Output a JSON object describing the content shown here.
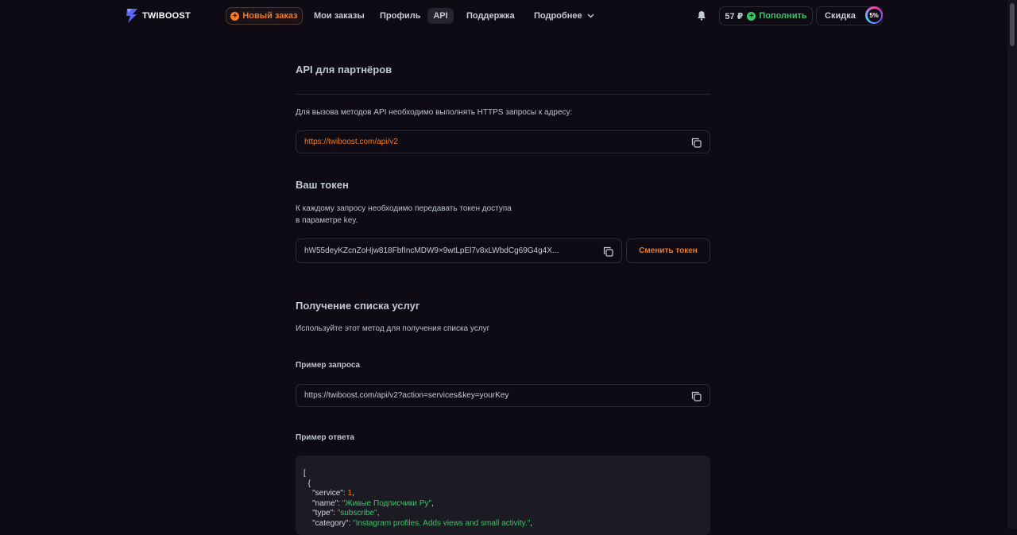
{
  "nav": {
    "brand": "TWIBOOST",
    "new_order": "Новый заказ",
    "my_orders": "Мои заказы",
    "profile": "Профиль",
    "api": "API",
    "support": "Поддержка",
    "more": "Подробнее",
    "balance": "57 ₽",
    "topup": "Пополнить",
    "discount_label": "Скидка",
    "discount_value": "5%"
  },
  "page": {
    "title": "API для партнёров",
    "intro": "Для вызова методов API необходимо выполнять HTTPS запросы к адресу:",
    "api_url": "https://twiboost.com/api/v2",
    "token_title": "Ваш токен",
    "token_desc_line1": "К каждому запросу необходимо передавать токен доступа",
    "token_desc_line2": "в параметре key.",
    "token_value": "hW55deyKZcnZoHjw818FbfIncMDW9×9wtLpEl7v8xLWbdCg69G4g4X...",
    "change_token": "Сменить токен",
    "services_title": "Получение списка услуг",
    "services_desc": "Используйте этот метод для получения списка услуг",
    "request_example_label": "Пример запроса",
    "request_example_url": "https://twiboost.com/api/v2?action=services&key=yourKey",
    "response_example_label": "Пример ответа"
  },
  "response": {
    "open_bracket": "[",
    "open_brace": "{",
    "service_key": "\"service\": ",
    "service_val": "1",
    "name_key": "\"name\": ",
    "name_val": "\"Живые Подписчики Ру\"",
    "type_key": "\"type\": ",
    "type_val": "\"subscribe\"",
    "category_key": "\"category\": ",
    "category_val": "\"Instagram profiles. Adds views and small activity.\""
  },
  "colors": {
    "accent": "#f07b2c",
    "success": "#3fc266",
    "background": "#0e0b14"
  }
}
